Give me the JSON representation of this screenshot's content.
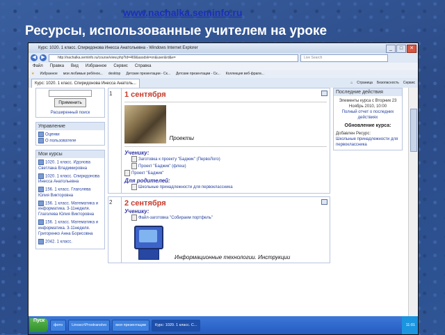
{
  "slide": {
    "url": "www.nachalka.seminfo.ru",
    "title": "Ресурсы, использованные учителем на уроке"
  },
  "browser": {
    "window_title": "Курс: 1020. 1 класс. Спиридонова Инесса Анатольевна - Windows Internet Explorer",
    "address": "http://nachalka.seminfo.ru/course/view.php?id=469&assdsk=on&user&rd&e=",
    "search_placeholder": "Live Search",
    "menu": [
      "Файл",
      "Правка",
      "Вид",
      "Избранное",
      "Сервис",
      "Справка"
    ],
    "favorites": [
      "Избранное",
      "мои любимые ребёнок...",
      "desktop",
      "Детские презентации - Ск...",
      "Детские презентации - Ск...",
      "Коллекция веб-фрагм..."
    ],
    "tab_label": "Курс: 1020. 1 класс. Спиридонова Инесса Анатоль...",
    "tools": [
      "Страница",
      "Безопасность",
      "Сервис"
    ]
  },
  "left": {
    "apply_button": "Применить",
    "advanced_search": "Расширенный поиск",
    "management_title": "Управление",
    "management_items": [
      "Оценки",
      "О пользователе"
    ],
    "mycourses_title": "Мои курсы",
    "courses": [
      "1020. 1 класс. Идолова Светлана Владимировна",
      "1020. 1 класс. Спиридонова Инесса Анатольевна",
      "156. 1 класс. Глаголева Юлия Викторовна",
      "156. 1 класс. Математика и информатика. 3-11неделя. Глаголева Юлия Викторовна",
      "156. 1 класс. Математика и информатика. 3-11неделя. Григоренко Анна Борисовна",
      "2042. 1 класс."
    ]
  },
  "center": {
    "sections": [
      {
        "num": "1",
        "date": "1 сентября",
        "project_label": "Проекты",
        "students_label": "Ученику:",
        "student_items": [
          "Заготовка к проекту \"Баджик\" (ПервоЛого)",
          "Проект \"Баджик\" (флеш)",
          "Проект \"Баджик\""
        ],
        "parents_label": "Для родителей:",
        "parent_items": [
          "Школьные принадлежности для первоклассника"
        ]
      },
      {
        "num": "2",
        "date": "2 сентября",
        "students_label": "Ученику:",
        "student_items": [
          "Файл-заготовка \"Собираем портфель\""
        ],
        "footer_text": "Информационные технологии. Инструкции"
      }
    ]
  },
  "right": {
    "recent_title": "Последние действия",
    "recent_text": "Элементы курса с Вторник 23 Ноябрь 2010, 10:00",
    "recent_link": "Полный отчет о последних действиях",
    "update_title": "Обновление курса:",
    "update_text": "Добавлен Ресурс:",
    "update_link": "Школьные принадлежности для первоклассника"
  },
  "taskbar": {
    "start": "Пуск",
    "items": [
      "фото",
      "Linoscr\\Prostranstvo",
      "моя презентации",
      "Курс: 1020. 1 класс. С..."
    ],
    "clock": "11:01"
  }
}
